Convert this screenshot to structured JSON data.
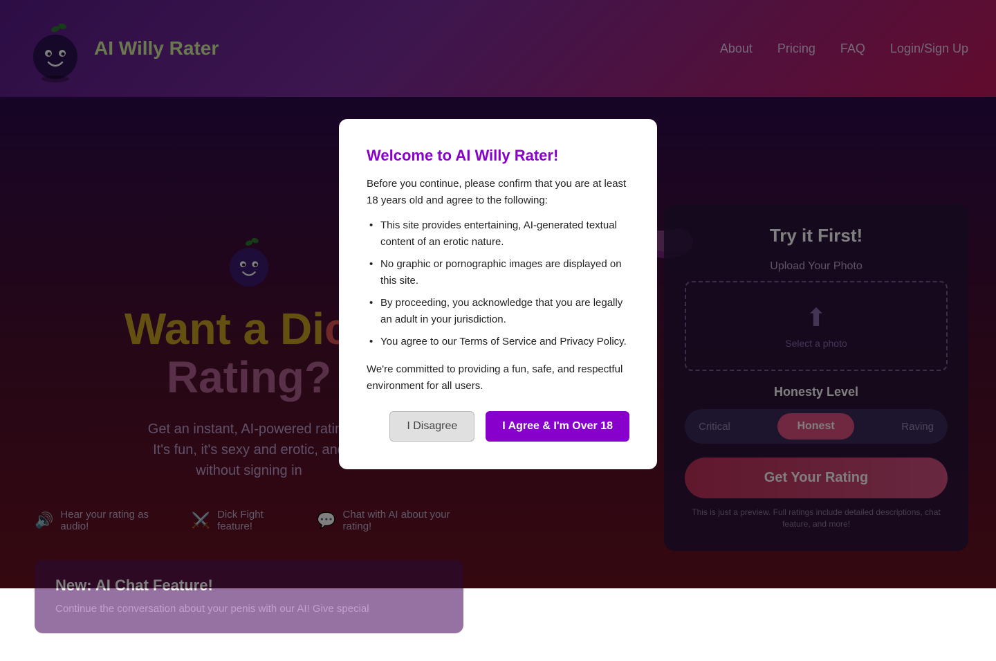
{
  "header": {
    "site_title": "AI Willy Rater",
    "nav": {
      "about": "About",
      "pricing": "Pricing",
      "faq": "FAQ",
      "login": "Login/Sign Up"
    }
  },
  "hero": {
    "title_word1": "Want a Di",
    "title_word2": "ck",
    "title_word3": "Rating?",
    "subtitle": "Get an instant, AI-powered rating of your penis!\nIt's fun, it's sexy and erotic, and you can try it\nwithout signing in!",
    "features": [
      {
        "icon": "🔊",
        "label": "Hear your rating as audio!"
      },
      {
        "icon": "⚔️",
        "label": "Dick Fight feature!"
      },
      {
        "icon": "💬",
        "label": "Chat with AI about your rating!"
      }
    ]
  },
  "new_feature": {
    "title": "New: AI Chat Feature!",
    "text": "Continue the conversation about your penis with our AI! Give special"
  },
  "right_panel": {
    "title": "Try it First!",
    "upload_label": "Upload Your Photo",
    "upload_text": "Select a photo",
    "honesty_label": "Honesty Level",
    "honesty_options": {
      "left": "Critical",
      "active": "Honest",
      "right": "Raving"
    },
    "cta_button": "Get Your Rating",
    "preview_note": "This is just a preview. Full ratings include detailed descriptions, chat feature, and more!"
  },
  "modal": {
    "title": "Welcome to AI Willy Rater!",
    "intro": "Before you continue, please confirm that you are at least 18 years old and agree to the following:",
    "points": [
      "This site provides entertaining, AI-generated textual content of an erotic nature.",
      "No graphic or pornographic images are displayed on this site.",
      "By proceeding, you acknowledge that you are legally an adult in your jurisdiction.",
      "You agree to our Terms of Service and Privacy Policy."
    ],
    "commitment": "We're committed to providing a fun, safe, and respectful environment for all users.",
    "disagree_label": "I Disagree",
    "agree_label": "I Agree & I'm Over 18"
  },
  "colors": {
    "header_gradient_start": "#5a1a8a",
    "header_gradient_end": "#c2185b",
    "modal_title": "#8800cc",
    "agree_btn": "#8800cc",
    "cta_btn": "#c0305a"
  }
}
